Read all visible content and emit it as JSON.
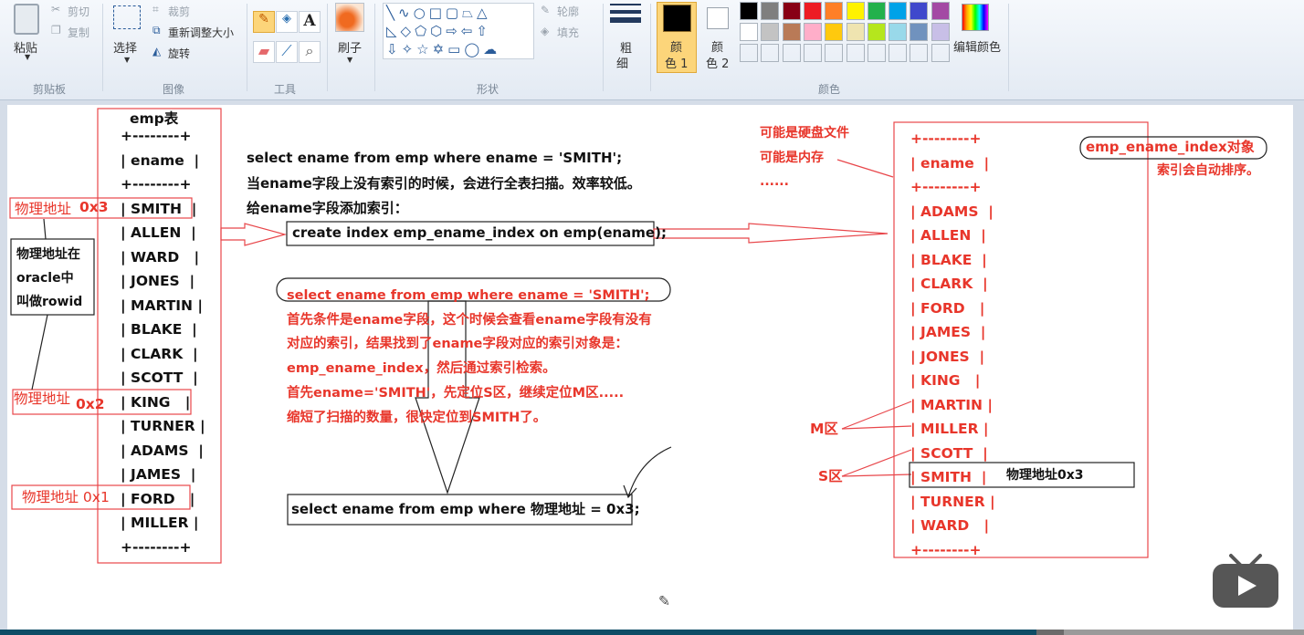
{
  "ribbon": {
    "clipboard": {
      "paste": "粘贴",
      "cut": "剪切",
      "copy": "复制",
      "group": "剪贴板"
    },
    "image": {
      "select": "选择",
      "crop": "裁剪",
      "resize": "重新调整大小",
      "rotate": "旋转",
      "group": "图像"
    },
    "tools": {
      "group": "工具",
      "text_glyph": "A"
    },
    "brush": {
      "label": "刷子"
    },
    "shapes": {
      "outline": "轮廓",
      "fill": "填充",
      "group": "形状"
    },
    "size": {
      "label1": "粗",
      "label2": "细"
    },
    "colors": {
      "color1_a": "颜",
      "color1_b": "色 1",
      "color2_a": "颜",
      "color2_b": "色 2",
      "edit": "编辑颜色",
      "group": "颜色",
      "row1": [
        "#000000",
        "#7f7f7f",
        "#880015",
        "#ed1c24",
        "#ff7f27",
        "#fff200",
        "#22b14c",
        "#00a2e8",
        "#3f48cc",
        "#a349a4"
      ],
      "row2": [
        "#ffffff",
        "#c3c3c3",
        "#b97a57",
        "#ffaec9",
        "#ffc90e",
        "#efe4b0",
        "#b5e61d",
        "#99d9ea",
        "#7092be",
        "#c8bfe7"
      ]
    }
  },
  "left_table": {
    "title": "emp表",
    "rows": [
      "+--------+",
      "| ename  |",
      "+--------+",
      "| SMITH  |",
      "| ALLEN  |",
      "| WARD   |",
      "| JONES  |",
      "| MARTIN |",
      "| BLAKE  |",
      "| CLARK  |",
      "| SCOTT  |",
      "| KING   |",
      "| TURNER |",
      "| ADAMS  |",
      "| JAMES  |",
      "| FORD   |",
      "| MILLER |",
      "+--------+"
    ]
  },
  "left_notes": {
    "addr3": "物理地址",
    "addr3_val": "0x3",
    "addr2": "物理地址",
    "addr2_val": "0x2",
    "addr1": "物理地址 0x1",
    "rowid": [
      "物理地址在",
      "oracle中",
      "叫做rowid"
    ]
  },
  "middle": {
    "lines": [
      "select ename from emp where ename = 'SMITH';",
      "当ename字段上没有索引的时候，会进行全表扫描。效率较低。",
      "给ename字段添加索引："
    ],
    "create": "create index emp_ename_index on emp(ename);",
    "explain": [
      "select ename from emp where ename = 'SMITH';",
      "首先条件是ename字段，这个时候会查看ename字段有没有",
      "对应的索引，结果找到了ename字段对应的索引对象是：",
      "emp_ename_index，然后通过索引检索。",
      "首先ename='SMITH'，先定位S区，继续定位M区.....",
      "缩短了扫描的数量，很快定位到SMITH了。"
    ],
    "final": "select ename from emp where 物理地址 = 0x3;"
  },
  "right": {
    "notes": [
      "可能是硬盘文件",
      "可能是内存",
      "......"
    ],
    "rows": [
      "+--------+",
      "| ename  |",
      "+--------+",
      "| ADAMS  |",
      "| ALLEN  |",
      "| BLAKE  |",
      "| CLARK  |",
      "| FORD   |",
      "| JAMES  |",
      "| JONES  |",
      "| KING   |",
      "| MARTIN |",
      "| MILLER |",
      "| SCOTT  |",
      "| SMITH  |",
      "| TURNER |",
      "| WARD   |",
      "+--------+"
    ],
    "index_obj": "emp_ename_index对象",
    "sorted": "索引会自动排序。",
    "m_zone": "M区",
    "s_zone": "S区",
    "smith_addr": "物理地址0x3"
  },
  "player": {
    "progress": 0.795,
    "buffered": 0.816
  }
}
